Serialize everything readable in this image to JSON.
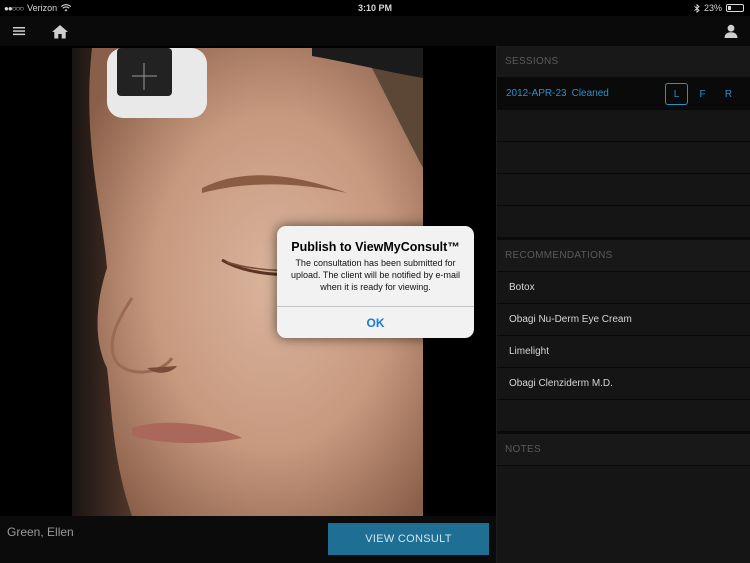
{
  "status_bar": {
    "carrier": "Verizon",
    "signal_dots": "●●○○○",
    "time": "3:10 PM",
    "battery_text": "23%",
    "battery_level": 0.23
  },
  "nav": {
    "menu_icon": "hamburger-menu-icon",
    "home_icon": "home-icon",
    "profile_icon": "user-icon"
  },
  "client": {
    "name": "Green, Ellen"
  },
  "actions": {
    "view_consult": "VIEW CONSULT"
  },
  "sessions": {
    "header": "SESSIONS",
    "items": [
      {
        "date": "2012-APR-23",
        "status": "Cleaned",
        "views": [
          "L",
          "F",
          "R"
        ],
        "active_view": "L"
      }
    ]
  },
  "recommendations": {
    "header": "RECOMMENDATIONS",
    "items": [
      {
        "label": "Botox"
      },
      {
        "label": "Obagi Nu-Derm Eye Cream"
      },
      {
        "label": "Limelight"
      },
      {
        "label": "Obagi Clenziderm M.D."
      }
    ]
  },
  "notes": {
    "header": "NOTES"
  },
  "alert": {
    "title": "Publish to ViewMyConsult™",
    "message": "The consultation has been submitted for upload. The client will be notified by e-mail when it is ready for viewing.",
    "ok": "OK"
  },
  "colors": {
    "accent": "#2e8fc6",
    "button": "#1e6f93",
    "alert_link": "#1a7bd6"
  }
}
